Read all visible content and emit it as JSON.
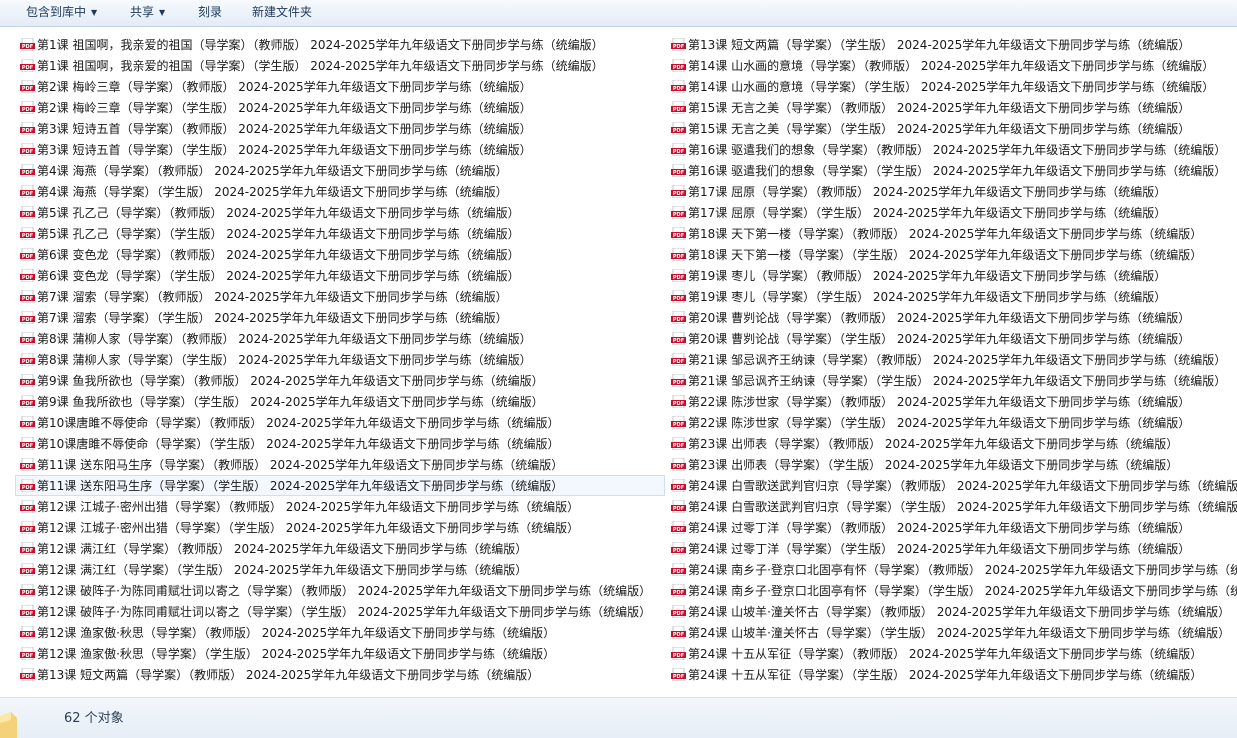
{
  "toolbar": {
    "include_in_library": "包含到库中",
    "share": "共享",
    "burn": "刻录",
    "new_folder": "新建文件夹"
  },
  "file_icon": "pdf-icon",
  "files_left": [
    "第1课 祖国啊，我亲爱的祖国（导学案）（教师版） 2024-2025学年九年级语文下册同步学与练（统编版）",
    "第1课 祖国啊，我亲爱的祖国（导学案）（学生版） 2024-2025学年九年级语文下册同步学与练（统编版）",
    "第2课 梅岭三章（导学案）（教师版） 2024-2025学年九年级语文下册同步学与练（统编版）",
    "第2课 梅岭三章（导学案）（学生版） 2024-2025学年九年级语文下册同步学与练（统编版）",
    "第3课 短诗五首（导学案）（教师版） 2024-2025学年九年级语文下册同步学与练（统编版）",
    "第3课 短诗五首（导学案）（学生版） 2024-2025学年九年级语文下册同步学与练（统编版）",
    "第4课 海燕（导学案）（教师版） 2024-2025学年九年级语文下册同步学与练（统编版）",
    "第4课 海燕（导学案）（学生版） 2024-2025学年九年级语文下册同步学与练（统编版）",
    "第5课 孔乙己（导学案）（教师版） 2024-2025学年九年级语文下册同步学与练（统编版）",
    "第5课 孔乙己（导学案）（学生版） 2024-2025学年九年级语文下册同步学与练（统编版）",
    "第6课 变色龙（导学案）（教师版） 2024-2025学年九年级语文下册同步学与练（统编版）",
    "第6课 变色龙（导学案）（学生版） 2024-2025学年九年级语文下册同步学与练（统编版）",
    "第7课 溜索（导学案）（教师版） 2024-2025学年九年级语文下册同步学与练（统编版）",
    "第7课 溜索（导学案）（学生版） 2024-2025学年九年级语文下册同步学与练（统编版）",
    "第8课 蒲柳人家（导学案）（教师版） 2024-2025学年九年级语文下册同步学与练（统编版）",
    "第8课 蒲柳人家（导学案）（学生版） 2024-2025学年九年级语文下册同步学与练（统编版）",
    "第9课 鱼我所欲也（导学案）（教师版） 2024-2025学年九年级语文下册同步学与练（统编版）",
    "第9课 鱼我所欲也（导学案）（学生版） 2024-2025学年九年级语文下册同步学与练（统编版）",
    "第10课唐雎不辱使命（导学案）（教师版） 2024-2025学年九年级语文下册同步学与练（统编版）",
    "第10课唐雎不辱使命（导学案）（学生版） 2024-2025学年九年级语文下册同步学与练（统编版）",
    "第11课 送东阳马生序（导学案）（教师版） 2024-2025学年九年级语文下册同步学与练（统编版）",
    "第11课 送东阳马生序（导学案）（学生版） 2024-2025学年九年级语文下册同步学与练（统编版）",
    "第12课 江城子·密州出猎（导学案）（教师版） 2024-2025学年九年级语文下册同步学与练（统编版）",
    "第12课 江城子·密州出猎（导学案）（学生版） 2024-2025学年九年级语文下册同步学与练（统编版）",
    "第12课 满江红（导学案）（教师版） 2024-2025学年九年级语文下册同步学与练（统编版）",
    "第12课 满江红（导学案）（学生版） 2024-2025学年九年级语文下册同步学与练（统编版）",
    "第12课 破阵子·为陈同甫赋壮词以寄之（导学案）（教师版） 2024-2025学年九年级语文下册同步学与练（统编版）",
    "第12课 破阵子·为陈同甫赋壮词以寄之（导学案）（学生版） 2024-2025学年九年级语文下册同步学与练（统编版）",
    "第12课 渔家傲·秋思（导学案）（教师版） 2024-2025学年九年级语文下册同步学与练（统编版）",
    "第12课 渔家傲·秋思（导学案）（学生版） 2024-2025学年九年级语文下册同步学与练（统编版）",
    "第13课 短文两篇（导学案）（教师版） 2024-2025学年九年级语文下册同步学与练（统编版）"
  ],
  "files_right": [
    "第13课 短文两篇（导学案）（学生版） 2024-2025学年九年级语文下册同步学与练（统编版）",
    "第14课 山水画的意境（导学案）（教师版） 2024-2025学年九年级语文下册同步学与练（统编版）",
    "第14课 山水画的意境（导学案）（学生版） 2024-2025学年九年级语文下册同步学与练（统编版）",
    "第15课 无言之美（导学案）（教师版） 2024-2025学年九年级语文下册同步学与练（统编版）",
    "第15课 无言之美（导学案）（学生版） 2024-2025学年九年级语文下册同步学与练（统编版）",
    "第16课 驱遣我们的想象（导学案）（教师版） 2024-2025学年九年级语文下册同步学与练（统编版）",
    "第16课 驱遣我们的想象（导学案）（学生版） 2024-2025学年九年级语文下册同步学与练（统编版）",
    "第17课 屈原（导学案）（教师版） 2024-2025学年九年级语文下册同步学与练（统编版）",
    "第17课 屈原（导学案）（学生版） 2024-2025学年九年级语文下册同步学与练（统编版）",
    "第18课 天下第一楼（导学案）（教师版） 2024-2025学年九年级语文下册同步学与练（统编版）",
    "第18课 天下第一楼（导学案）（学生版） 2024-2025学年九年级语文下册同步学与练（统编版）",
    "第19课 枣儿（导学案）（教师版） 2024-2025学年九年级语文下册同步学与练（统编版）",
    "第19课 枣儿（导学案）（学生版） 2024-2025学年九年级语文下册同步学与练（统编版）",
    "第20课 曹刿论战（导学案）（教师版） 2024-2025学年九年级语文下册同步学与练（统编版）",
    "第20课 曹刿论战（导学案）（学生版） 2024-2025学年九年级语文下册同步学与练（统编版）",
    "第21课 邹忌讽齐王纳谏（导学案）（教师版） 2024-2025学年九年级语文下册同步学与练（统编版）",
    "第21课 邹忌讽齐王纳谏（导学案）（学生版） 2024-2025学年九年级语文下册同步学与练（统编版）",
    "第22课 陈涉世家（导学案）（教师版） 2024-2025学年九年级语文下册同步学与练（统编版）",
    "第22课 陈涉世家（导学案）（学生版） 2024-2025学年九年级语文下册同步学与练（统编版）",
    "第23课 出师表（导学案）（教师版） 2024-2025学年九年级语文下册同步学与练（统编版）",
    "第23课 出师表（导学案）（学生版） 2024-2025学年九年级语文下册同步学与练（统编版）",
    "第24课 白雪歌送武判官归京（导学案）（教师版） 2024-2025学年九年级语文下册同步学与练（统编版",
    "第24课 白雪歌送武判官归京（导学案）（学生版） 2024-2025学年九年级语文下册同步学与练（统编版",
    "第24课 过零丁洋（导学案）（教师版） 2024-2025学年九年级语文下册同步学与练（统编版）",
    "第24课 过零丁洋（导学案）（学生版） 2024-2025学年九年级语文下册同步学与练（统编版）",
    "第24课 南乡子·登京口北固亭有怀（导学案）（教师版） 2024-2025学年九年级语文下册同步学与练（统",
    "第24课 南乡子·登京口北固亭有怀（导学案）（学生版） 2024-2025学年九年级语文下册同步学与练（统",
    "第24课 山坡羊·潼关怀古（导学案）（教师版） 2024-2025学年九年级语文下册同步学与练（统编版）",
    "第24课 山坡羊·潼关怀古（导学案）（学生版） 2024-2025学年九年级语文下册同步学与练（统编版）",
    "第24课 十五从军征（导学案）（教师版） 2024-2025学年九年级语文下册同步学与练（统编版）",
    "第24课 十五从军征（导学案）（学生版） 2024-2025学年九年级语文下册同步学与练（统编版）"
  ],
  "selected_left_index": 21,
  "status": {
    "count_text": "62 个对象"
  },
  "colors": {
    "pdf_red": "#c8102e",
    "toolbar_text": "#1e395b",
    "selection_border": "#cfe0f5"
  }
}
